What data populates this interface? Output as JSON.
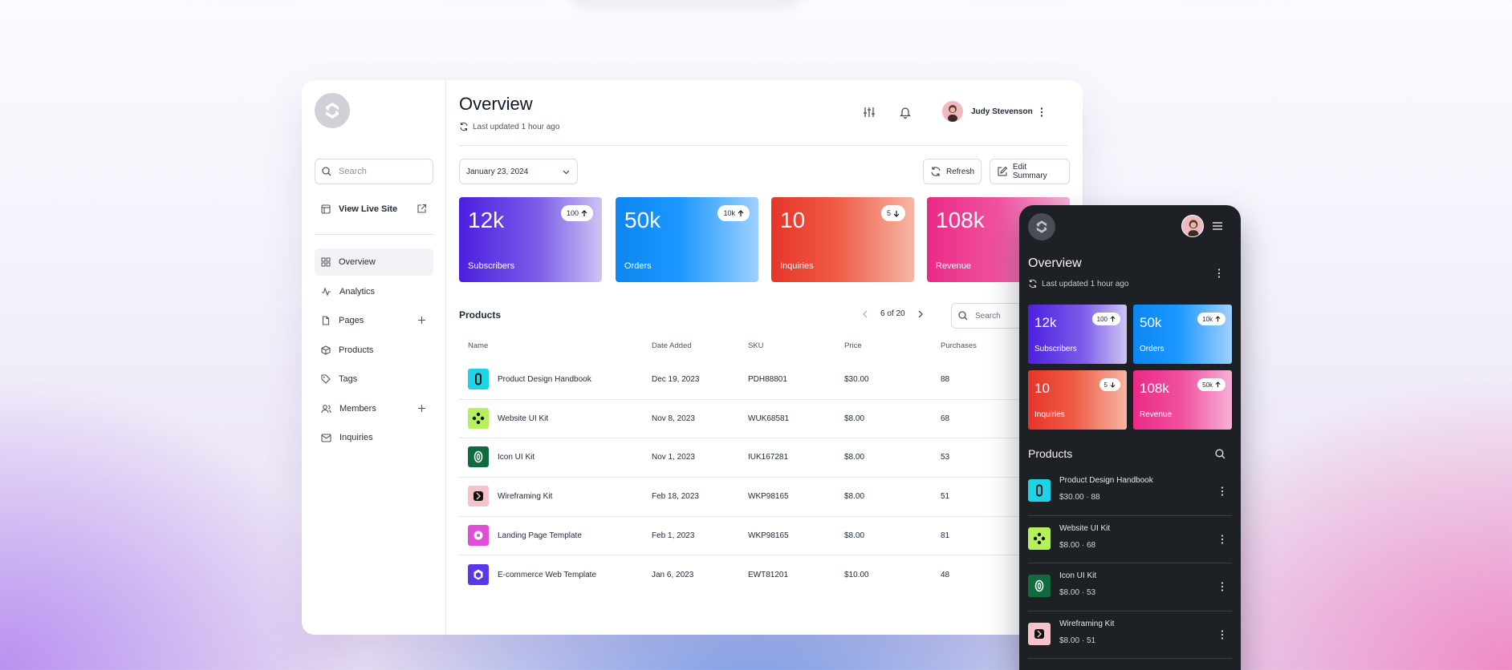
{
  "desktop": {
    "sidebar": {
      "search_placeholder": "Search",
      "view_live_site": "View Live Site",
      "nav": [
        {
          "label": "Overview",
          "icon": "grid-icon",
          "active": true
        },
        {
          "label": "Analytics",
          "icon": "activity-icon"
        },
        {
          "label": "Pages",
          "icon": "file-icon"
        },
        {
          "label": "Products",
          "icon": "box-icon"
        },
        {
          "label": "Tags",
          "icon": "tag-icon"
        },
        {
          "label": "Members",
          "icon": "users-icon"
        },
        {
          "label": "Inquiries",
          "icon": "mail-icon"
        }
      ]
    },
    "header": {
      "title": "Overview",
      "updated": "Last updated 1 hour ago",
      "user_name": "Judy Stevenson"
    },
    "toolbar": {
      "date": "January 23, 2024",
      "refresh": "Refresh",
      "edit_summary": "Edit Summary"
    },
    "stats": [
      {
        "value": "12k",
        "label": "Subscribers",
        "badge": "100",
        "trend": "up"
      },
      {
        "value": "50k",
        "label": "Orders",
        "badge": "10k",
        "trend": "up"
      },
      {
        "value": "10",
        "label": "Inquiries",
        "badge": "5",
        "trend": "down"
      },
      {
        "value": "108k",
        "label": "Revenue",
        "badge": "50k",
        "trend": "up"
      }
    ],
    "products": {
      "title": "Products",
      "pager": "6 of 20",
      "search_placeholder": "Search",
      "columns": [
        "Name",
        "Date Added",
        "SKU",
        "Price",
        "Purchases"
      ],
      "rows": [
        {
          "name": "Product Design Handbook",
          "date": "Dec 19, 2023",
          "sku": "PDH88801",
          "price": "$30.00",
          "purchases": "88",
          "icon_bg": "#1ed3e6"
        },
        {
          "name": "Website UI Kit",
          "date": "Nov 8, 2023",
          "sku": "WUK68581",
          "price": "$8.00",
          "purchases": "68",
          "icon_bg": "#b6f05a"
        },
        {
          "name": "Icon UI Kit",
          "date": "Nov 1, 2023",
          "sku": "IUK167281",
          "price": "$8.00",
          "purchases": "53",
          "icon_bg": "#0f6b3d"
        },
        {
          "name": "Wireframing Kit",
          "date": "Feb 18, 2023",
          "sku": "WKP98165",
          "price": "$8.00",
          "purchases": "51",
          "icon_bg": "#f6c2cc"
        },
        {
          "name": "Landing Page Template",
          "date": "Feb 1, 2023",
          "sku": "WKP98165",
          "price": "$8.00",
          "purchases": "81",
          "icon_bg": "#e04ed6"
        },
        {
          "name": "E-commerce Web Template",
          "date": "Jan 6, 2023",
          "sku": "EWT81201",
          "price": "$10.00",
          "purchases": "48",
          "icon_bg": "#5a37e8"
        }
      ]
    }
  },
  "mobile": {
    "title": "Overview",
    "updated": "Last updated 1 hour ago",
    "products_title": "Products",
    "items": [
      {
        "name": "Product Design Handbook",
        "price": "$30.00",
        "sep": "·",
        "count": "88",
        "icon_bg": "#1ed3e6"
      },
      {
        "name": "Website UI Kit",
        "price": "$8.00",
        "sep": "·",
        "count": "68",
        "icon_bg": "#b6f05a"
      },
      {
        "name": "Icon UI Kit",
        "price": "$8.00",
        "sep": "·",
        "count": "53",
        "icon_bg": "#0f6b3d"
      },
      {
        "name": "Wireframing Kit",
        "price": "$8.00",
        "sep": "·",
        "count": "51",
        "icon_bg": "#f6c2cc"
      }
    ]
  }
}
